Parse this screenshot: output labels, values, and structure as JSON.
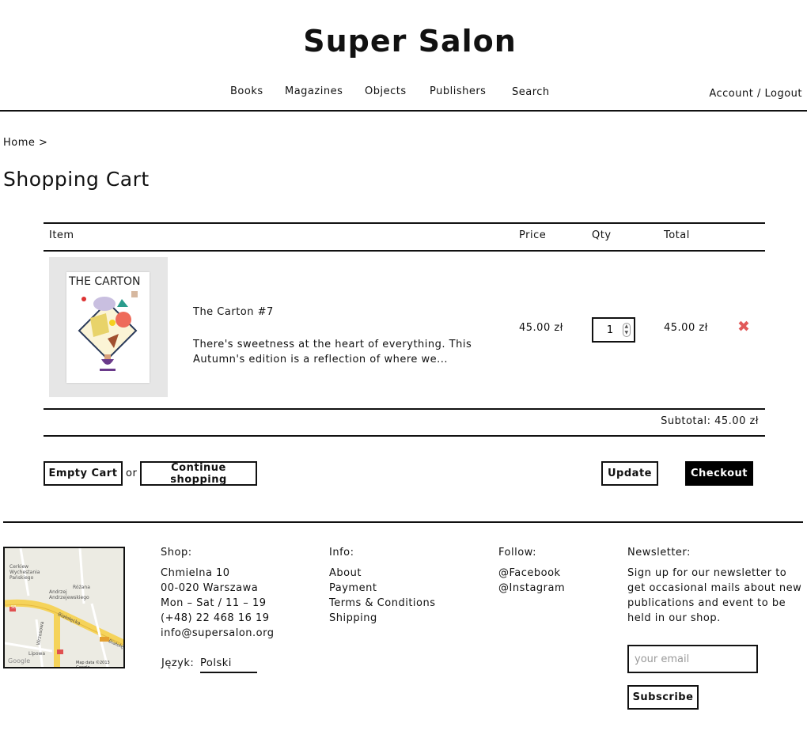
{
  "header": {
    "logo": "Super Salon",
    "nav": [
      "Books",
      "Magazines",
      "Objects",
      "Publishers",
      "Search"
    ],
    "account": "Account / Logout"
  },
  "breadcrumb": "Home >",
  "page_title": "Shopping Cart",
  "cart": {
    "columns": {
      "item": "Item",
      "price": "Price",
      "qty": "Qty",
      "total": "Total"
    },
    "items": [
      {
        "cover_title": "THE CARTON",
        "title": "The Carton #7",
        "description": "There's sweetness at the heart of everything. This Autumn's edition is a reflection of where we...",
        "price": "45.00 zł",
        "qty": "1",
        "total": "45.00 zł"
      }
    ],
    "subtotal": "Subtotal: 45.00 zł",
    "remove_color": "#e15a5a"
  },
  "actions": {
    "empty_cart": "Empty Cart",
    "or": "or",
    "continue_shopping": "Continue shopping",
    "update": "Update",
    "checkout": "Checkout"
  },
  "footer": {
    "map": {
      "labels": [
        "Cerkiew Wychestania Pańskiego",
        "Różana",
        "Andrzej Andrzejewskiego",
        "Białołęcka",
        "Wrzosowa",
        "Lipowa",
        "Białołęcka"
      ],
      "road_number": "S8",
      "google": "Google",
      "attribution": "Map data ©2013 Google"
    },
    "shop": {
      "heading": "Shop:",
      "lines": [
        "Chmielna 10",
        "00-020 Warszawa",
        "Mon – Sat / 11 – 19",
        "(+48) 22 468 16 19",
        "info@supersalon.org"
      ]
    },
    "info": {
      "heading": "Info:",
      "links": [
        "About",
        "Payment",
        "Terms & Conditions",
        "Shipping"
      ]
    },
    "follow": {
      "heading": "Follow:",
      "links": [
        "@Facebook",
        "@Instagram"
      ]
    },
    "newsletter": {
      "heading": "Newsletter:",
      "lines": [
        "Sign up for our newsletter to",
        "get occasional mails about new",
        "publications and event to be",
        "held in our shop."
      ],
      "placeholder": "your email",
      "subscribe": "Subscribe"
    },
    "language": {
      "label": "Język:",
      "value": "Polski"
    }
  }
}
